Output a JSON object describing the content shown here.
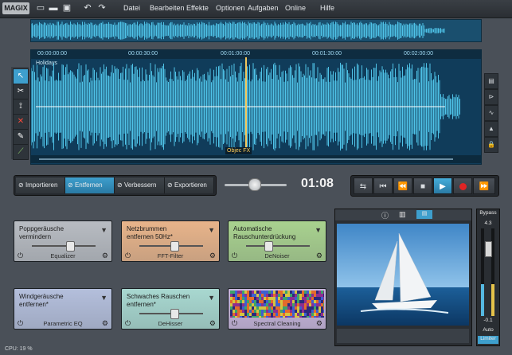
{
  "app": {
    "logo": "MAGIX"
  },
  "menu": [
    "Datei",
    "Bearbeiten",
    "Effekte",
    "Optionen",
    "Aufgaben",
    "Online",
    "Hilfe"
  ],
  "toolbar_icons": [
    "new-file-icon",
    "open-folder-icon",
    "save-icon",
    "undo-icon",
    "redo-icon"
  ],
  "ruler": {
    "ticks": [
      "00:00:00:00",
      "00:00:30:00",
      "00:01:00:00",
      "00:01:30:00",
      "00:02:00:00"
    ],
    "track_label": "Holidays",
    "object_label": "Objec",
    "fx_label": "FX"
  },
  "modes": [
    {
      "label": "Importieren",
      "active": false
    },
    {
      "label": "Entfernen",
      "active": true
    },
    {
      "label": "Verbessern",
      "active": false
    },
    {
      "label": "Exportieren",
      "active": false
    }
  ],
  "timecode": "01:08",
  "transport": [
    "loop-icon",
    "skip-back-icon",
    "rewind-icon",
    "stop-icon",
    "play-icon",
    "record-icon",
    "fast-forward-icon"
  ],
  "effects": [
    {
      "title": "Poppgeräusche\nvermindern",
      "label": "Equalizer",
      "color": "#b8bcc2",
      "level": 0.6
    },
    {
      "title": "Netzbrummen\nentfernen 50Hz*",
      "label": "FFT-Filter",
      "color": "#e8b48a",
      "level": 0.55
    },
    {
      "title": "Automatische\nRauschunterdrückung",
      "label": "DeNoiser",
      "color": "#a9d28f",
      "level": 0.35
    },
    {
      "title": "Windgeräusche\nentfernen*",
      "label": "Parametric EQ",
      "color": "#b4bfdc",
      "level": null
    },
    {
      "title": "Schwaches Rauschen\nentfernen*",
      "label": "DeHisser",
      "color": "#a8d8d0",
      "level": 0.55
    },
    {
      "title": "",
      "label": "Spectral Cleaning",
      "color": "#c9b7de",
      "level": null
    }
  ],
  "meters": {
    "bypass_label": "Bypass",
    "top_value": "4.3",
    "bottom_value": "-0.1",
    "auto_label": "Auto",
    "limiter_label": "Limiter"
  },
  "status": {
    "cpu": "CPU: 19 %"
  },
  "colors": {
    "accent": "#3e9fcd",
    "wave": "#4fc3e8",
    "record": "#e02424"
  }
}
